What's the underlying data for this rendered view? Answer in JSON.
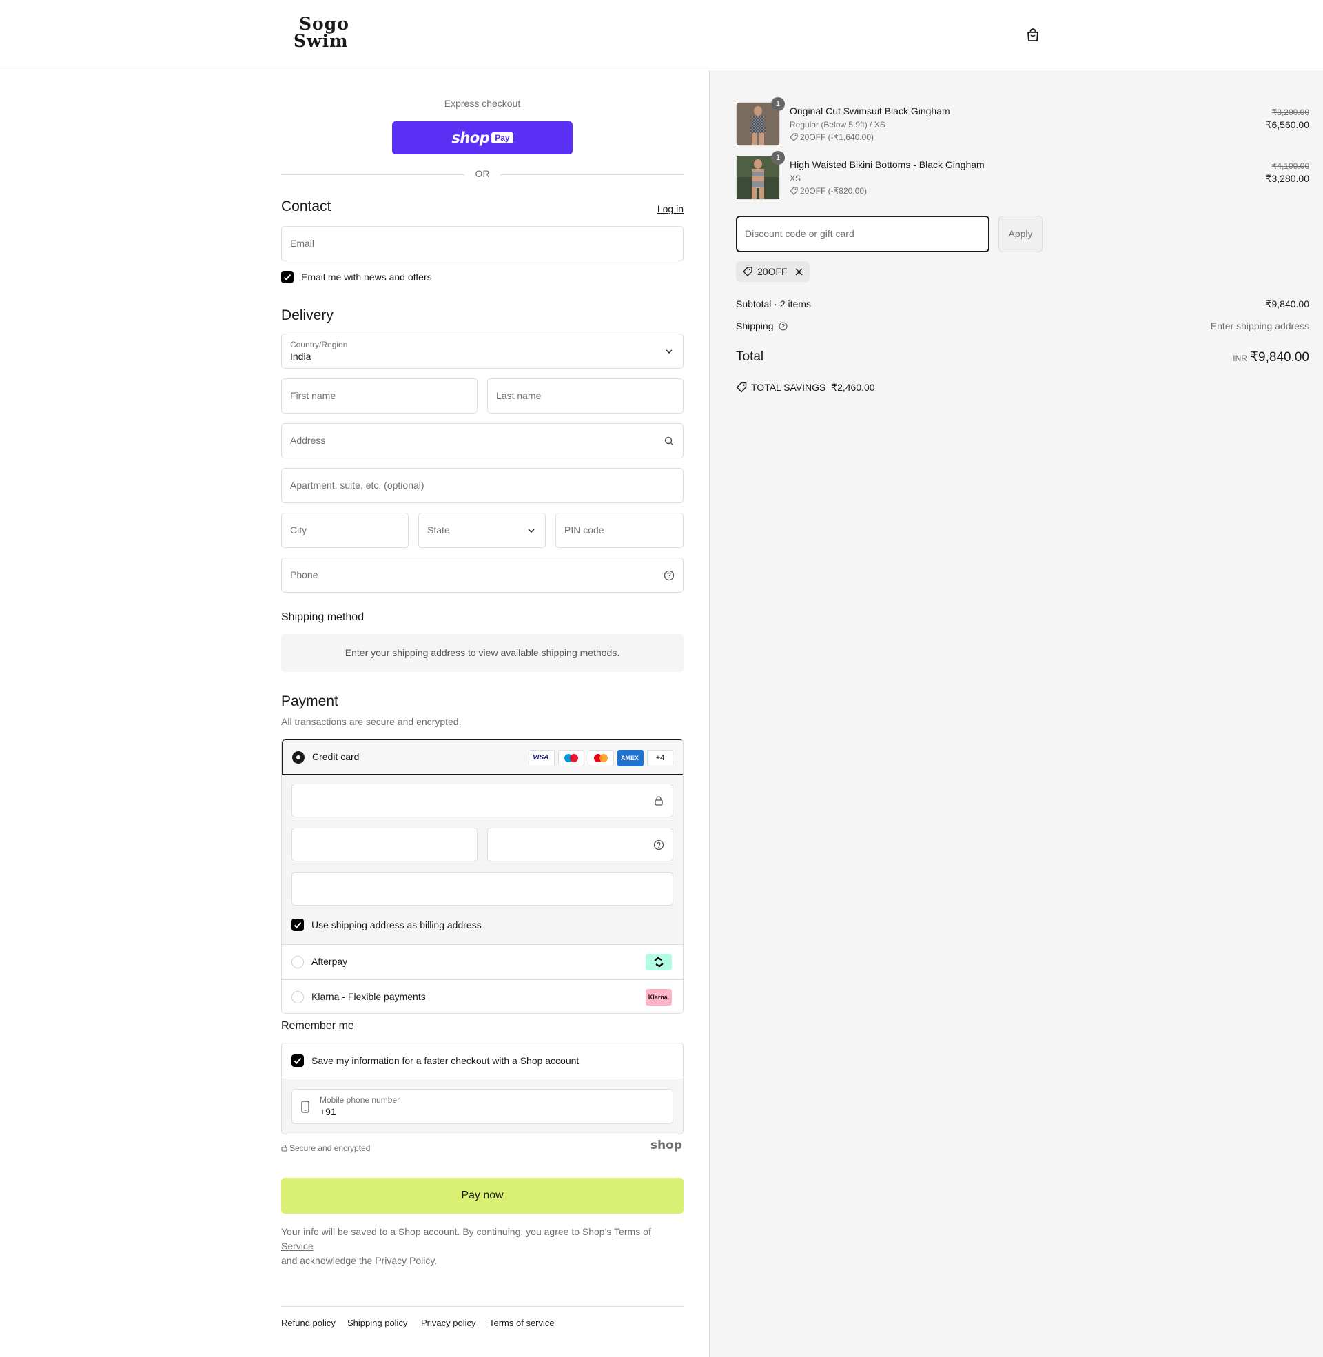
{
  "header": {
    "logo_line1": "Sogo",
    "logo_line2": "Swim"
  },
  "express": {
    "label": "Express checkout",
    "shop_pay_word": "shop",
    "shop_pay_badge": "Pay",
    "or": "OR"
  },
  "contact": {
    "title": "Contact",
    "login": "Log in",
    "email_placeholder": "Email",
    "news_label": "Email me with news and offers"
  },
  "delivery": {
    "title": "Delivery",
    "country_label": "Country/Region",
    "country_value": "India",
    "first_name": "First name",
    "last_name": "Last name",
    "address": "Address",
    "apartment": "Apartment, suite, etc. (optional)",
    "city": "City",
    "state": "State",
    "pin": "PIN code",
    "phone": "Phone"
  },
  "shipping_method": {
    "title": "Shipping method",
    "info": "Enter your shipping address to view available shipping methods."
  },
  "payment": {
    "title": "Payment",
    "subtitle": "All transactions are secure and encrypted.",
    "credit_card": "Credit card",
    "card_logos": [
      "VISA",
      "maestro",
      "mastercard",
      "AMEX"
    ],
    "more_cards": "+4",
    "billing_label": "Use shipping address as billing address",
    "afterpay": "Afterpay",
    "klarna": "Klarna - Flexible payments",
    "klarna_badge": "Klarna."
  },
  "remember": {
    "title": "Remember me",
    "save_label": "Save my information for a faster checkout with a Shop account",
    "mobile_label": "Mobile phone number",
    "mobile_value": "+91",
    "secure": "Secure and encrypted",
    "shop_brand": "shop"
  },
  "pay_now": "Pay now",
  "legal": {
    "line1_prefix": "Your info will be saved to a Shop account. By continuing, you agree to Shop’s ",
    "terms": "Terms of Service",
    "line2_prefix": "and acknowledge the ",
    "privacy": "Privacy Policy",
    "line2_suffix": "."
  },
  "footer": {
    "refund": "Refund policy",
    "shipping": "Shipping policy",
    "privacy": "Privacy policy",
    "terms": "Terms of service"
  },
  "summary": {
    "items": [
      {
        "name": "Original Cut Swimsuit Black Gingham",
        "variant": "Regular (Below 5.9ft) / XS",
        "discount": "20OFF (-₹1,640.00)",
        "old_price": "₹8,200.00",
        "price": "₹6,560.00",
        "qty": "1"
      },
      {
        "name": "High Waisted Bikini Bottoms - Black Gingham",
        "variant": "XS",
        "discount": "20OFF (-₹820.00)",
        "old_price": "₹4,100.00",
        "price": "₹3,280.00",
        "qty": "1"
      }
    ],
    "discount_placeholder": "Discount code or gift card",
    "apply": "Apply",
    "applied_code": "20OFF",
    "subtotal_label": "Subtotal · 2 items",
    "subtotal_value": "₹9,840.00",
    "shipping_label": "Shipping",
    "shipping_value": "Enter shipping address",
    "total_label": "Total",
    "total_currency": "INR",
    "total_value": "₹9,840.00",
    "savings_label": "TOTAL SAVINGS",
    "savings_value": "₹2,460.00"
  },
  "colors": {
    "shop_pay": "#5a31f4",
    "pay_now_bg": "#d9f073",
    "afterpay_bg": "#b2fce4",
    "klarna_bg": "#ffb3c7"
  }
}
